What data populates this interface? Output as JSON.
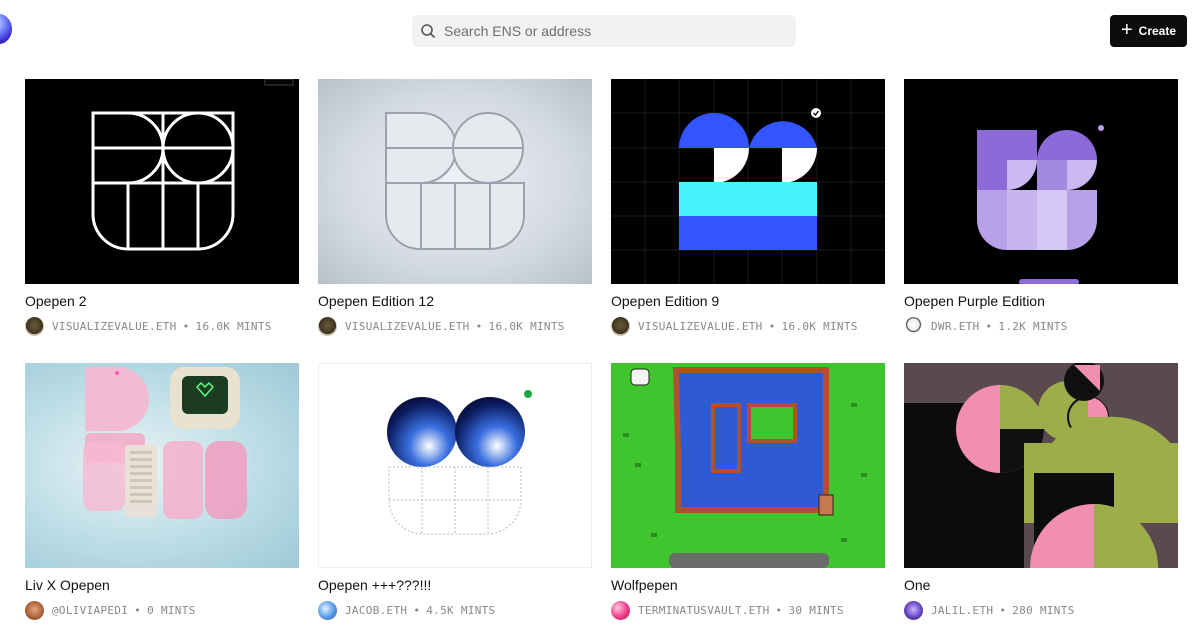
{
  "header": {
    "search_placeholder": "Search ENS or address",
    "create_label": "Create"
  },
  "cards": [
    {
      "title": "Opepen 2",
      "creator": "VISUALIZEVALUE.ETH",
      "mints": "16.0K MINTS"
    },
    {
      "title": "Opepen Edition 12",
      "creator": "VISUALIZEVALUE.ETH",
      "mints": "16.0K MINTS"
    },
    {
      "title": "Opepen Edition 9",
      "creator": "VISUALIZEVALUE.ETH",
      "mints": "16.0K MINTS"
    },
    {
      "title": "Opepen Purple Edition",
      "creator": "DWR.ETH",
      "mints": "1.2K MINTS"
    },
    {
      "title": "Liv X Opepen",
      "creator": "@OLIVIAPEDI",
      "mints": "0 MINTS"
    },
    {
      "title": "Opepen +++???!!!",
      "creator": "JACOB.ETH",
      "mints": "4.5K MINTS"
    },
    {
      "title": "Wolfpepen",
      "creator": "TERMINATUSVAULT.ETH",
      "mints": "30 MINTS"
    },
    {
      "title": "One",
      "creator": "JALIL.ETH",
      "mints": "280 MINTS"
    }
  ],
  "meta_separator": "•",
  "colors": {
    "create_bg": "#0c0c0c",
    "search_bg": "#f2f2f2",
    "meta_text": "#888888"
  }
}
